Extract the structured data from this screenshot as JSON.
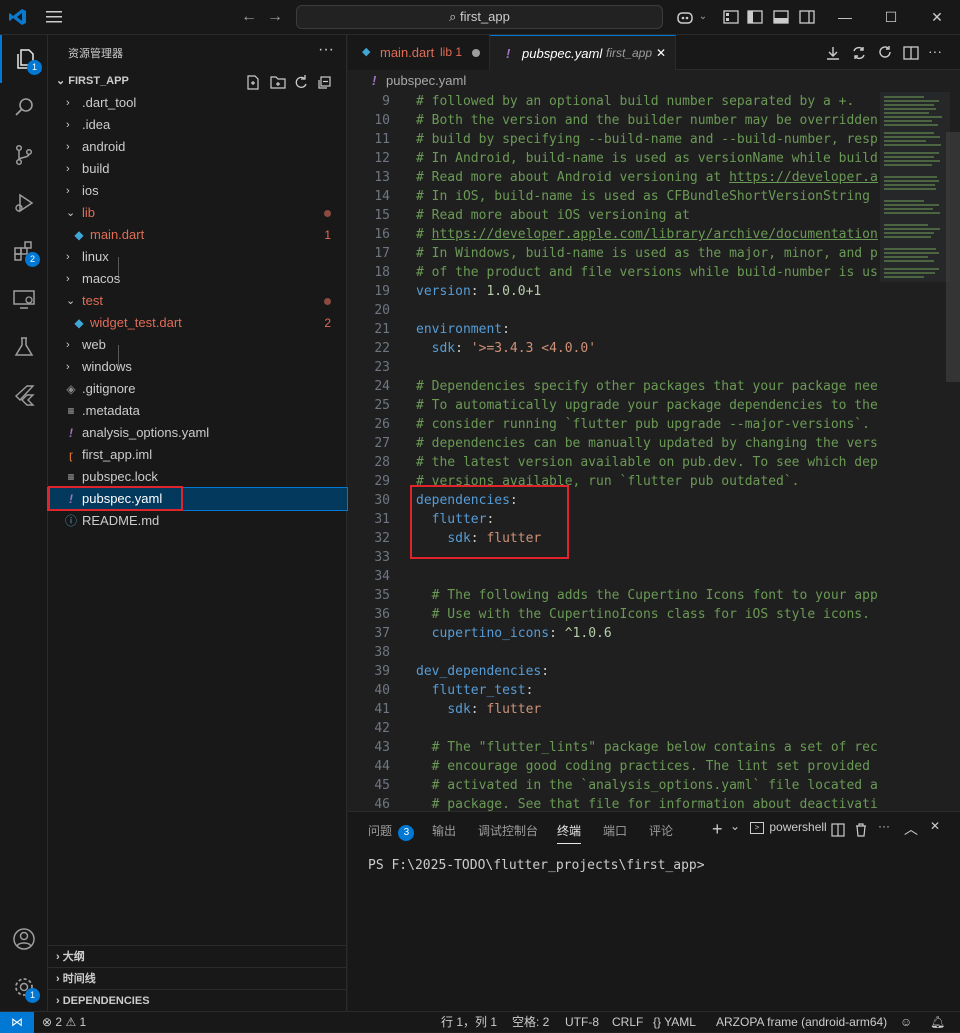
{
  "titlebar": {
    "search_text": "first_app",
    "back_icon": "arrow-left-icon",
    "forward_icon": "arrow-right-icon"
  },
  "activity": {
    "explorer_badge": "1",
    "extensions_badge": "2",
    "settings_badge": "1"
  },
  "sidebar": {
    "title": "资源管理器",
    "folder": "FIRST_APP",
    "items": [
      {
        "label": ".dart_tool",
        "kind": "folder",
        "collapsed": true
      },
      {
        "label": ".idea",
        "kind": "folder",
        "collapsed": true
      },
      {
        "label": "android",
        "kind": "folder",
        "collapsed": true
      },
      {
        "label": "build",
        "kind": "folder",
        "collapsed": true
      },
      {
        "label": "ios",
        "kind": "folder",
        "collapsed": true
      },
      {
        "label": "lib",
        "kind": "folder",
        "collapsed": false
      },
      {
        "label": "main.dart",
        "kind": "dart-file",
        "problems": "1"
      },
      {
        "label": "linux",
        "kind": "folder",
        "collapsed": true
      },
      {
        "label": "macos",
        "kind": "folder",
        "collapsed": true
      },
      {
        "label": "test",
        "kind": "folder",
        "collapsed": false
      },
      {
        "label": "widget_test.dart",
        "kind": "dart-file",
        "problems": "2"
      },
      {
        "label": "web",
        "kind": "folder",
        "collapsed": true
      },
      {
        "label": "windows",
        "kind": "folder",
        "collapsed": true
      },
      {
        "label": ".gitignore",
        "kind": "git-file"
      },
      {
        "label": ".metadata",
        "kind": "text-file"
      },
      {
        "label": "analysis_options.yaml",
        "kind": "yaml-file"
      },
      {
        "label": "first_app.iml",
        "kind": "rss-file"
      },
      {
        "label": "pubspec.lock",
        "kind": "text-file"
      },
      {
        "label": "pubspec.yaml",
        "kind": "yaml-file",
        "selected": true
      },
      {
        "label": "README.md",
        "kind": "info-file"
      }
    ],
    "outline_section": "大纲",
    "timeline_section": "时间线",
    "dependencies_section": "DEPENDENCIES"
  },
  "editor": {
    "tabs": [
      {
        "label": "main.dart",
        "desc": "lib 1",
        "active": false
      },
      {
        "label": "pubspec.yaml",
        "desc": "first_app",
        "active": true
      }
    ],
    "breadcrumb": "pubspec.yaml",
    "lines": [
      {
        "n": "9",
        "text": "# followed by an optional build number separated by a +."
      },
      {
        "n": "10",
        "text": "# Both the version and the builder number may be overridden"
      },
      {
        "n": "11",
        "text": "# build by specifying --build-name and --build-number, respe"
      },
      {
        "n": "12",
        "text": "# In Android, build-name is used as versionName while build-"
      },
      {
        "n": "13",
        "text": "# Read more about Android versioning at https://developer.an"
      },
      {
        "n": "14",
        "text": "# In iOS, build-name is used as CFBundleShortVersionString w"
      },
      {
        "n": "15",
        "text": "# Read more about iOS versioning at"
      },
      {
        "n": "16",
        "text": "# https://developer.apple.com/library/archive/documentation/"
      },
      {
        "n": "17",
        "text": "# In Windows, build-name is used as the major, minor, and pa"
      },
      {
        "n": "18",
        "text": "# of the product and file versions while build-number is use"
      },
      {
        "n": "19",
        "text": "version: 1.0.0+1"
      },
      {
        "n": "20",
        "text": ""
      },
      {
        "n": "21",
        "text": "environment:"
      },
      {
        "n": "22",
        "text": "  sdk: '>=3.4.3 <4.0.0'"
      },
      {
        "n": "23",
        "text": ""
      },
      {
        "n": "24",
        "text": "# Dependencies specify other packages that your package need"
      },
      {
        "n": "25",
        "text": "# To automatically upgrade your package dependencies to the"
      },
      {
        "n": "26",
        "text": "# consider running `flutter pub upgrade --major-versions`. A"
      },
      {
        "n": "27",
        "text": "# dependencies can be manually updated by changing the versi"
      },
      {
        "n": "28",
        "text": "# the latest version available on pub.dev. To see which depe"
      },
      {
        "n": "29",
        "text": "# versions available, run `flutter pub outdated`."
      },
      {
        "n": "30",
        "text": "dependencies:"
      },
      {
        "n": "31",
        "text": "  flutter:"
      },
      {
        "n": "32",
        "text": "    sdk: flutter"
      },
      {
        "n": "33",
        "text": ""
      },
      {
        "n": "34",
        "text": ""
      },
      {
        "n": "35",
        "text": "  # The following adds the Cupertino Icons font to your appl"
      },
      {
        "n": "36",
        "text": "  # Use with the CupertinoIcons class for iOS style icons."
      },
      {
        "n": "37",
        "text": "  cupertino_icons: ^1.0.6"
      },
      {
        "n": "38",
        "text": ""
      },
      {
        "n": "39",
        "text": "dev_dependencies:"
      },
      {
        "n": "40",
        "text": "  flutter_test:"
      },
      {
        "n": "41",
        "text": "    sdk: flutter"
      },
      {
        "n": "42",
        "text": ""
      },
      {
        "n": "43",
        "text": "  # The \"flutter_lints\" package below contains a set of reco"
      },
      {
        "n": "44",
        "text": "  # encourage good coding practices. The lint set provided b"
      },
      {
        "n": "45",
        "text": "  # activated in the `analysis_options.yaml` file located at"
      },
      {
        "n": "46",
        "text": "  # package. See that file for information about deactivatin"
      }
    ]
  },
  "panel": {
    "tabs": [
      "问题",
      "输出",
      "调试控制台",
      "终端",
      "端口",
      "评论"
    ],
    "problems_count": "3",
    "active_tab": "终端",
    "shell": "powershell",
    "terminal_prompt": "PS F:\\2025-TODO\\flutter_projects\\first_app>"
  },
  "status": {
    "errors": "2",
    "warnings": "1",
    "position": "行 1，列 1",
    "spaces": "空格: 2",
    "encoding": "UTF-8",
    "eol": "CRLF",
    "language": "YAML",
    "device": "ARZOPA frame (android-arm64)"
  },
  "colors": {
    "accent": "#0078d4",
    "highlight_box": "#e0242b",
    "problem_red": "#e06c56"
  }
}
